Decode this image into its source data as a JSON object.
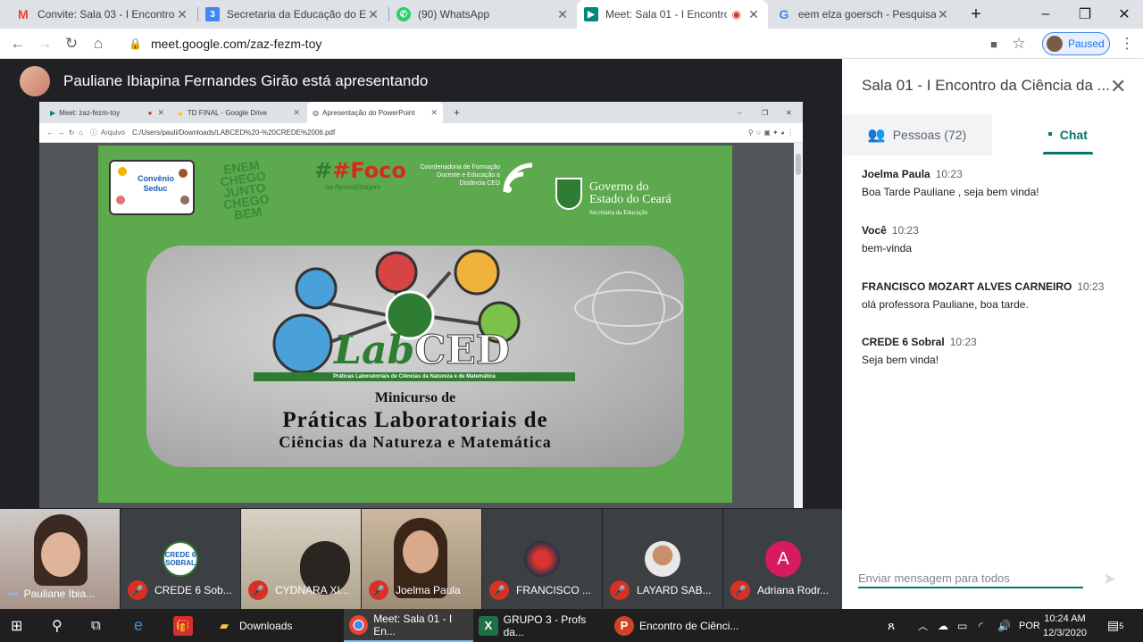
{
  "browser": {
    "tabs": [
      {
        "title": "Convite: Sala 03 - I Encontro d",
        "icon": "gmail-icon",
        "active": false
      },
      {
        "title": "Secretaria da Educação do Esta",
        "icon": "sheets-icon",
        "active": false
      },
      {
        "title": "(90) WhatsApp",
        "icon": "whatsapp-icon",
        "active": false
      },
      {
        "title": "Meet: Sala 01 - I Encontro",
        "icon": "meet-icon",
        "active": true
      },
      {
        "title": "eem elza goersch - Pesquisa G",
        "icon": "google-icon",
        "active": false
      }
    ],
    "url": "meet.google.com/zaz-fezm-toy",
    "profile_status": "Paused"
  },
  "meet": {
    "presenter_text": "Pauliane Ibiapina Fernandes Girão está apresentando",
    "shared_screen": {
      "tabs": [
        "Meet: zaz-fezm-toy",
        "TD FINAL - Google Drive",
        "Apresentação do PowerPoint"
      ],
      "addr_label": "Arquivo",
      "addr_path": "C:/Users/pauli/Downloads/LABCED%20-%20CREDE%2006.pdf",
      "slide": {
        "logo_convenio": "Convênio Seduc",
        "logo_enem": "ENEM CHEGO JUNTO CHEGO BEM",
        "logo_foco": "#Foco",
        "logo_foco_sub": "na Aprendizagem",
        "logo_ced": "Coordenadoria de Formação Docente e Educação a Distância CED",
        "logo_gov1": "Governo do",
        "logo_gov2": "Estado do Ceará",
        "logo_gov_sub": "Secretaria da Educação",
        "lab": "Lab",
        "ced": "CED",
        "lab_bar": "Práticas Laboratoriais de Ciências da Natureza e de Matemática",
        "title1": "Minicurso de",
        "title2": "Práticas Laboratoriais de",
        "title3": "Ciências da Natureza e Matemática"
      }
    },
    "participants": [
      {
        "name": "Pauliane Ibia...",
        "muted": false
      },
      {
        "name": "CREDE 6 Sob...",
        "muted": true
      },
      {
        "name": "CYDNARA XI...",
        "muted": true
      },
      {
        "name": "Joelma Paula",
        "muted": true
      },
      {
        "name": "FRANCISCO ...",
        "muted": true
      },
      {
        "name": "LAYARD SAB...",
        "muted": true
      },
      {
        "name": "Adriana Rodr...",
        "muted": true,
        "initial": "A"
      }
    ]
  },
  "panel": {
    "title": "Sala 01 - I Encontro da Ciência da ...",
    "people_tab": "Pessoas (72)",
    "chat_tab": "Chat",
    "messages": [
      {
        "sender": "Joelma Paula",
        "time": "10:23",
        "text": "Boa Tarde Pauliane , seja bem vinda!"
      },
      {
        "sender": "Você",
        "time": "10:23",
        "text": "bem-vinda"
      },
      {
        "sender": "FRANCISCO MOZART ALVES CARNEIRO",
        "time": "10:23",
        "text": "olá professora Pauliane, boa tarde."
      },
      {
        "sender": "CREDE 6 Sobral",
        "time": "10:23",
        "text": "Seja bem vinda!"
      }
    ],
    "input_placeholder": "Enviar mensagem para todos"
  },
  "taskbar": {
    "items": [
      "Downloads",
      "Meet: Sala 01 - I En...",
      "GRUPO 3 - Profs da...",
      "Encontro de Ciênci..."
    ],
    "lang": "POR",
    "time": "10:24 AM",
    "date": "12/3/2020",
    "notifications": "5"
  },
  "colors": {
    "meet_accent": "#00796b",
    "slide_green": "#5da94d",
    "mute_red": "#d93025"
  }
}
